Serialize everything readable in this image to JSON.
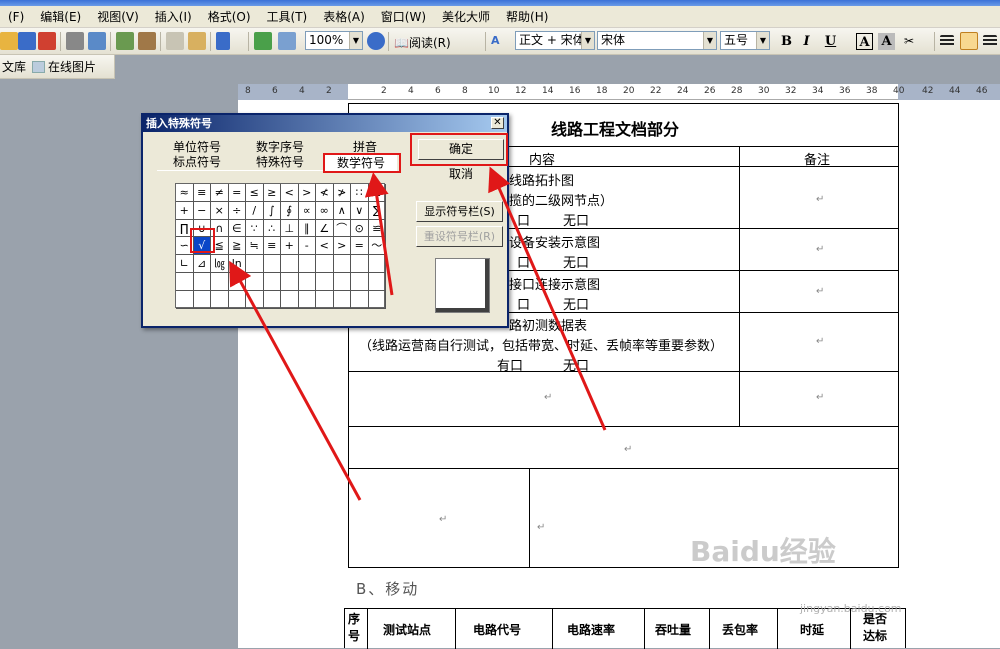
{
  "menu": [
    "(F)",
    "编辑(E)",
    "视图(V)",
    "插入(I)",
    "格式(O)",
    "工具(T)",
    "表格(A)",
    "窗口(W)",
    "美化大师",
    "帮助(H)"
  ],
  "toolbar": {
    "zoom": "100%",
    "read_label": "阅读(R)",
    "style_label": "正文 + 宋体",
    "font": "宋体",
    "size": "五号",
    "bold": "B",
    "italic": "I",
    "underline": "U",
    "charbox": "A",
    "charshade": "A"
  },
  "toolbar2": {
    "wenku": "文库",
    "online_pic": "在线图片"
  },
  "ruler": [
    "8",
    "6",
    "4",
    "2",
    "2",
    "4",
    "6",
    "8",
    "10",
    "12",
    "14",
    "16",
    "18",
    "20",
    "22",
    "24",
    "26",
    "28",
    "30",
    "32",
    "34",
    "36",
    "38",
    "40",
    "42",
    "44",
    "46"
  ],
  "dialog": {
    "title": "插入特殊符号",
    "tabs_row1": [
      "单位符号",
      "数字序号",
      "拼音"
    ],
    "tabs_row2": [
      "标点符号",
      "特殊符号",
      "数学符号"
    ],
    "ok": "确定",
    "cancel": "取消",
    "show_bar": "显示符号栏(S)",
    "reset_bar": "重设符号栏(R)",
    "symbols": [
      "≈",
      "≡",
      "≠",
      "=",
      "≤",
      "≥",
      "<",
      ">",
      "≮",
      "≯",
      "∷",
      "±",
      "+",
      "−",
      "×",
      "÷",
      "/",
      "∫",
      "∮",
      "∝",
      "∞",
      "∧",
      "∨",
      "∑",
      "∏",
      "∪",
      "∩",
      "∈",
      "∵",
      "∴",
      "⊥",
      "∥",
      "∠",
      "⌒",
      "⊙",
      "≌",
      "∽",
      "√",
      "≦",
      "≧",
      "≒",
      "≡",
      "+",
      "-",
      "<",
      ">",
      "=",
      "～",
      "∟",
      "⊿",
      "㏒",
      "ln"
    ]
  },
  "doc": {
    "title": "线路工程文档部分",
    "col_content": "内容",
    "col_remark": "备注",
    "r1a": "线路拓扑图",
    "r1b": "揽的二级网节点）",
    "r1c": "口",
    "r1d": "无口",
    "r2a": "设备安装示意图",
    "r2c": "口",
    "r2d": "无口",
    "r3a": "接口连接示意图",
    "r3c": "口",
    "r3d": "无口",
    "r4a": "路初测数据表",
    "r4b": "（线路运营商自行测试，包括带宽、时延、丢帧率等重要参数）",
    "r4c": "有口",
    "r4d": "无口",
    "section": "B、移动",
    "t2": [
      "序号",
      "测试站点",
      "电路代号",
      "电路速率",
      "吞吐量",
      "丢包率",
      "时延",
      "是否达标"
    ]
  },
  "watermark": {
    "brand": "Baidu经验",
    "url": "jingyan.baidu.com"
  }
}
